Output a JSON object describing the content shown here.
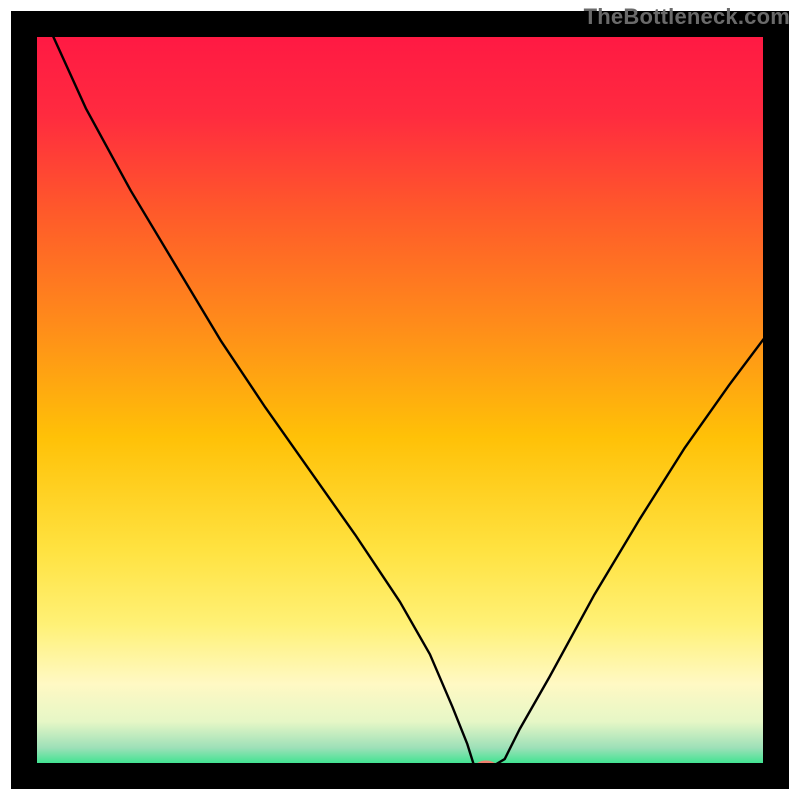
{
  "watermark": "TheBottleneck.com",
  "chart_data": {
    "type": "line",
    "title": "",
    "xlabel": "",
    "ylabel": "",
    "xlim": [
      0,
      100
    ],
    "ylim": [
      0,
      100
    ],
    "grid": false,
    "legend": false,
    "background_gradient": {
      "stops": [
        {
          "offset": 0.0,
          "color": "#ff1744"
        },
        {
          "offset": 0.12,
          "color": "#ff2b3f"
        },
        {
          "offset": 0.25,
          "color": "#ff5a2a"
        },
        {
          "offset": 0.4,
          "color": "#ff8c1a"
        },
        {
          "offset": 0.55,
          "color": "#ffc107"
        },
        {
          "offset": 0.7,
          "color": "#ffe240"
        },
        {
          "offset": 0.8,
          "color": "#fff176"
        },
        {
          "offset": 0.88,
          "color": "#fff9c4"
        },
        {
          "offset": 0.93,
          "color": "#e6f7c6"
        },
        {
          "offset": 0.965,
          "color": "#9de0b8"
        },
        {
          "offset": 1.0,
          "color": "#00e676"
        }
      ]
    },
    "series": [
      {
        "name": "bottleneck-curve",
        "color": "#000000",
        "x": [
          3,
          8,
          14,
          20,
          26,
          32,
          38,
          44,
          50,
          54,
          57,
          59,
          60,
          62,
          64,
          66,
          70,
          76,
          82,
          88,
          94,
          100
        ],
        "y": [
          100,
          89,
          78,
          68,
          58,
          49,
          40.5,
          32,
          23,
          16,
          9,
          4,
          0.8,
          0.8,
          2,
          6,
          13,
          24,
          34,
          43.5,
          52,
          60
        ]
      }
    ],
    "marker": {
      "name": "optimum-point",
      "x": 61.5,
      "y": 0.8,
      "color": "#ef7f6f",
      "rx": 1.6,
      "ry": 1.0
    },
    "frame": {
      "color": "#000000",
      "width": 4
    }
  }
}
